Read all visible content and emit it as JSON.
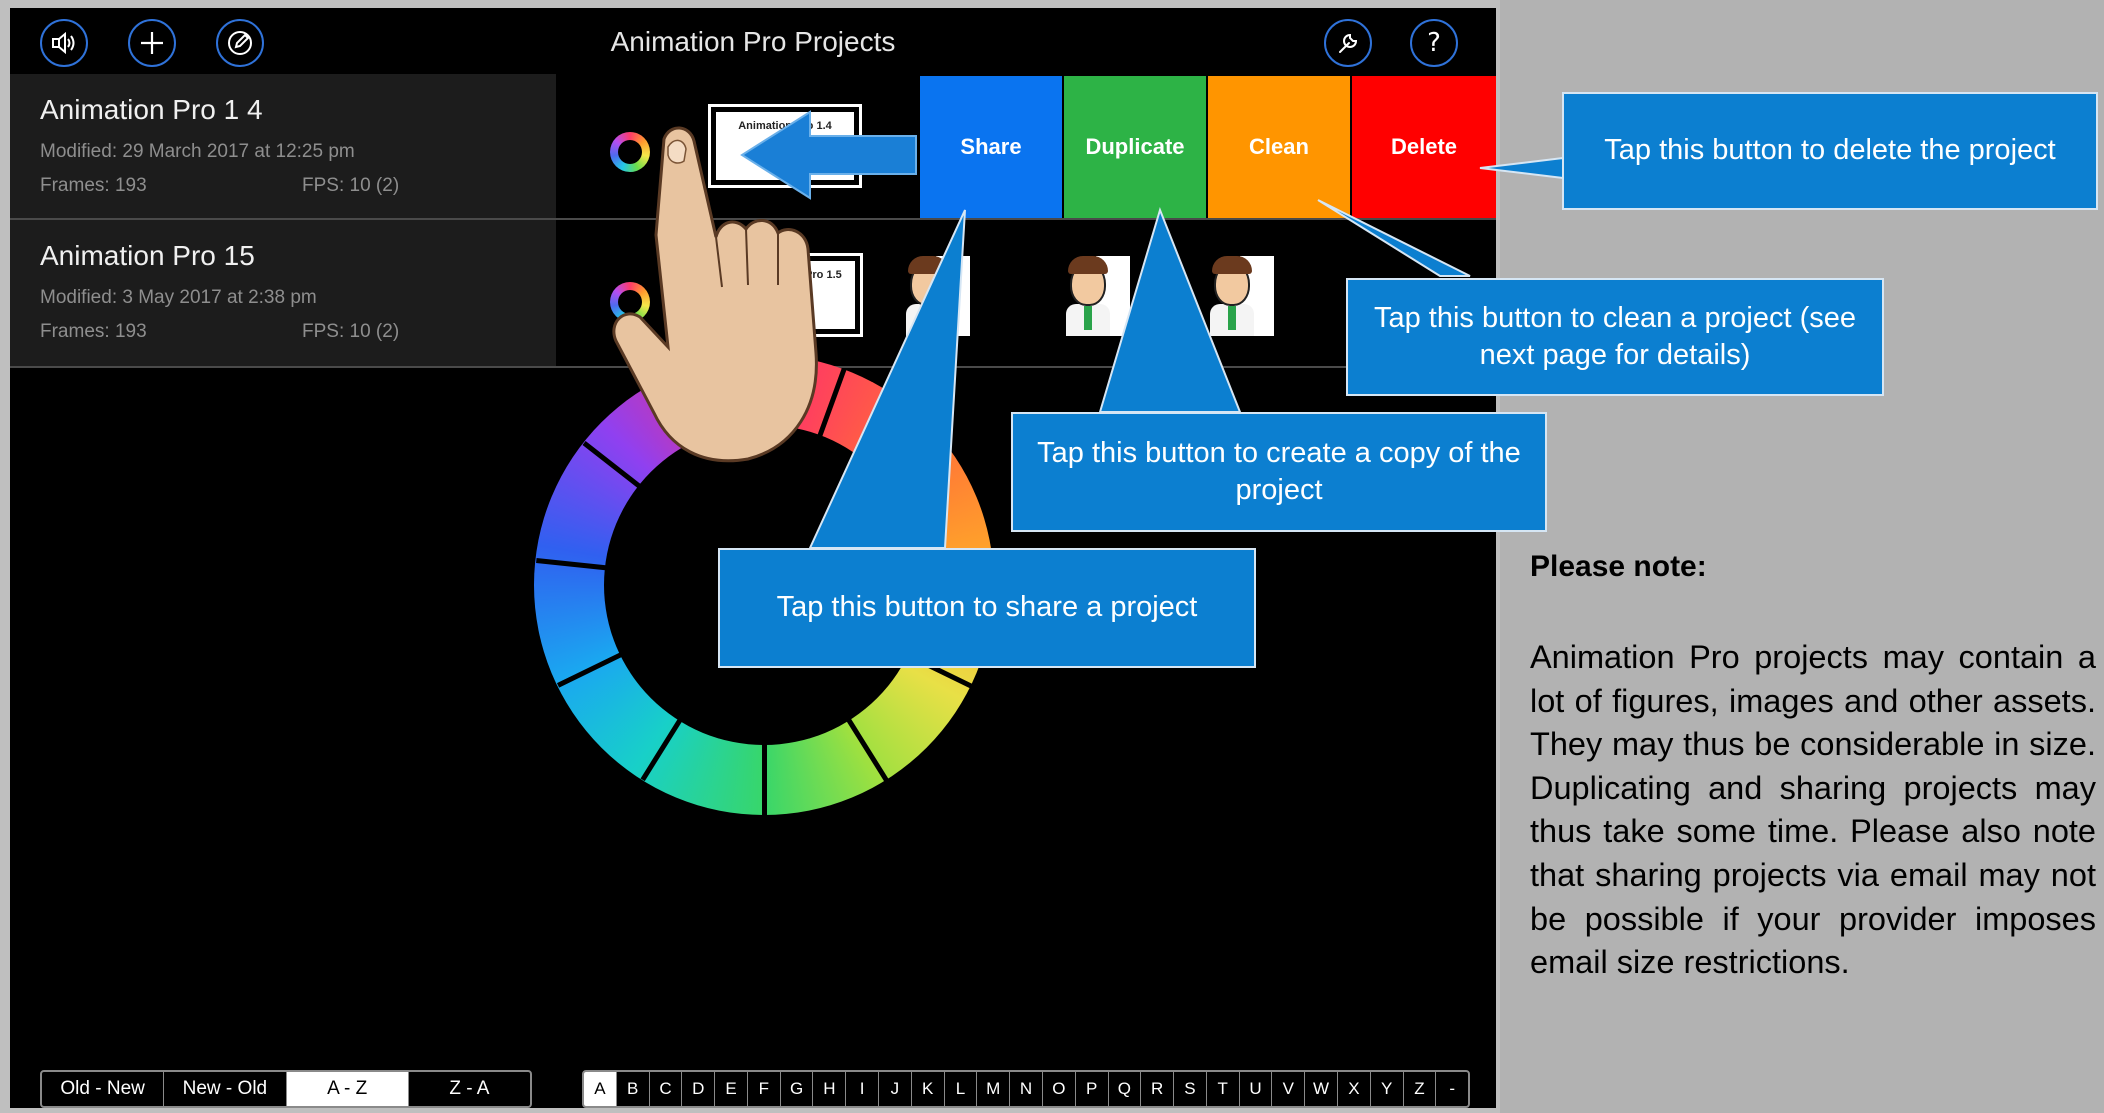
{
  "app": {
    "title": "Animation Pro Projects",
    "top_buttons": [
      "sound",
      "add",
      "edit",
      "settings",
      "help"
    ],
    "help_glyph": "?"
  },
  "projects": [
    {
      "title": "Animation Pro 1 4",
      "modified": "Modified: 29 March 2017 at 12:25 pm",
      "frames": "Frames: 193",
      "fps": "FPS: 10 (2)",
      "thumb_label": "Animation Pro 1.4"
    },
    {
      "title": "Animation Pro 15",
      "modified": "Modified: 3 May 2017 at 2:38 pm",
      "frames": "Frames: 193",
      "fps": "FPS: 10 (2)",
      "thumb_label": "Animation Pro 1.5"
    }
  ],
  "actions": {
    "share": "Share",
    "duplicate": "Duplicate",
    "clean": "Clean",
    "delete": "Delete",
    "colors": {
      "share": "#0a74f0",
      "duplicate": "#2db346",
      "clean": "#ff9500",
      "delete": "#ff0000"
    }
  },
  "sort": {
    "options": [
      "Old - New",
      "New - Old",
      "A - Z",
      "Z - A"
    ],
    "selected": "A - Z"
  },
  "alphabet": {
    "letters": [
      "A",
      "B",
      "C",
      "D",
      "E",
      "F",
      "G",
      "H",
      "I",
      "J",
      "K",
      "L",
      "M",
      "N",
      "O",
      "P",
      "Q",
      "R",
      "S",
      "T",
      "U",
      "V",
      "W",
      "X",
      "Y",
      "Z",
      "-"
    ],
    "selected": "A"
  },
  "callouts": {
    "delete": "Tap this button to delete the project",
    "clean": "Tap this button to clean a project (see next page for details)",
    "duplicate": "Tap this button to create a copy of the project",
    "share": "Tap this button to share a project"
  },
  "note": {
    "heading": "Please note:",
    "body": "Animation Pro projects may contain a lot of figures, images and other assets. They may thus be considerable in size. Duplicating and sharing projects may thus take some time. Please also note that sharing projects via email may not be possible if your provider imposes email size restrictions."
  },
  "colors": {
    "accent": "#2f72d9",
    "callout": "#0c7fd0"
  }
}
